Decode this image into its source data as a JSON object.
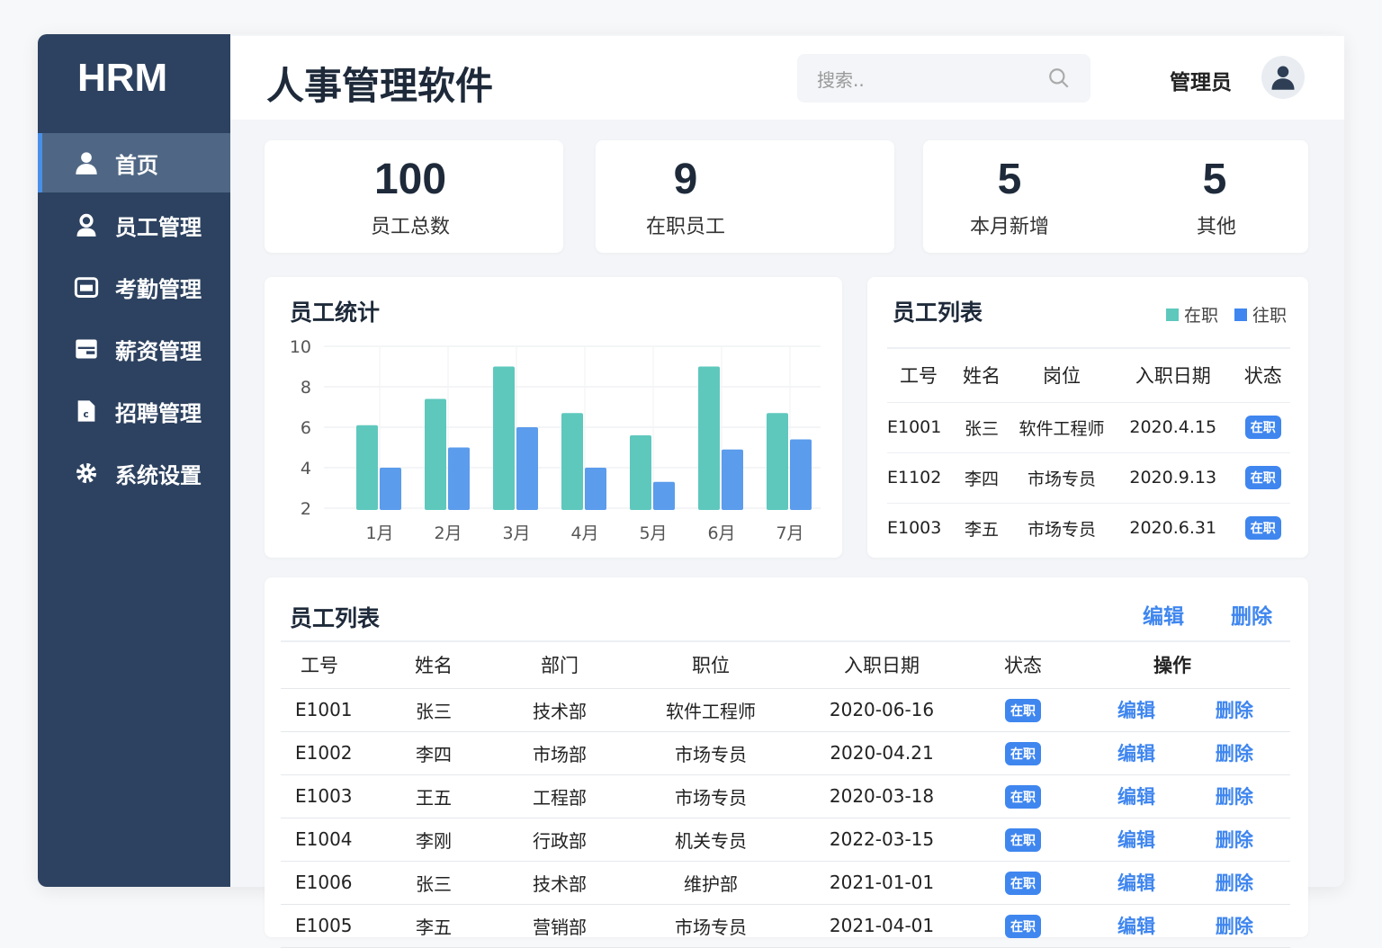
{
  "app": {
    "logo": "HRM",
    "title": "人事管理软件"
  },
  "sidebar": {
    "items": [
      {
        "label": "首页"
      },
      {
        "label": "员工管理"
      },
      {
        "label": "考勤管理"
      },
      {
        "label": "薪资管理"
      },
      {
        "label": "招聘管理"
      },
      {
        "label": "系统设置"
      }
    ]
  },
  "header": {
    "search_placeholder": "搜索..",
    "user": "管理员"
  },
  "stats": [
    {
      "value": "100",
      "label": "员工总数"
    },
    {
      "value": "9",
      "label": "在职员工"
    },
    {
      "value": "5",
      "label": "本月新增"
    },
    {
      "value": "5",
      "label": "其他"
    }
  ],
  "chart_data": {
    "type": "bar",
    "title": "员工统计",
    "categories": [
      "1月",
      "2月",
      "3月",
      "4月",
      "5月",
      "6月",
      "7月"
    ],
    "series": [
      {
        "name": "在职",
        "color": "#5ec8bd",
        "values": [
          6.1,
          7.4,
          9,
          6.7,
          5.6,
          9,
          6.7
        ]
      },
      {
        "name": "往职",
        "color": "#5b9cec",
        "values": [
          4.0,
          5.0,
          6.0,
          4.0,
          3.3,
          4.9,
          5.4
        ]
      }
    ],
    "yticks": [
      "10",
      "8",
      "6",
      "4",
      "2"
    ],
    "ylim": [
      2,
      10
    ],
    "grid": true
  },
  "list_small": {
    "title": "员工列表",
    "legend": [
      "在职",
      "往职"
    ],
    "headers": [
      "工号",
      "姓名",
      "岗位",
      "入职日期",
      "状态"
    ],
    "rows": [
      [
        "E1001",
        "张三",
        "软件工程师",
        "2020.4.15",
        "在职"
      ],
      [
        "E1102",
        "李四",
        "市场专员",
        "2020.9.13",
        "在职"
      ],
      [
        "E1003",
        "李五",
        "市场专员",
        "2020.6.31",
        "在职"
      ]
    ]
  },
  "list_main": {
    "title": "员工列表",
    "edit": "编辑",
    "delete": "删除",
    "headers": [
      "工号",
      "姓名",
      "部门",
      "职位",
      "入职日期",
      "状态",
      "操作"
    ],
    "rows": [
      [
        "E1001",
        "张三",
        "技术部",
        "软件工程师",
        "2020-06-16",
        "在职",
        "编辑",
        "删除"
      ],
      [
        "E1002",
        "李四",
        "市场部",
        "市场专员",
        "2020-04.21",
        "在职",
        "编辑",
        "删除"
      ],
      [
        "E1003",
        "王五",
        "工程部",
        "市场专员",
        "2020-03-18",
        "在职",
        "编辑",
        "删除"
      ],
      [
        "E1004",
        "李刚",
        "行政部",
        "机关专员",
        "2022-03-15",
        "在职",
        "编辑",
        "删除"
      ],
      [
        "E1006",
        "张三",
        "技术部",
        "维护部",
        "2021-01-01",
        "在职",
        "编辑",
        "删除"
      ],
      [
        "E1005",
        "李五",
        "营销部",
        "市场专员",
        "2021-04-01",
        "在职",
        "编辑",
        "删除"
      ]
    ]
  }
}
